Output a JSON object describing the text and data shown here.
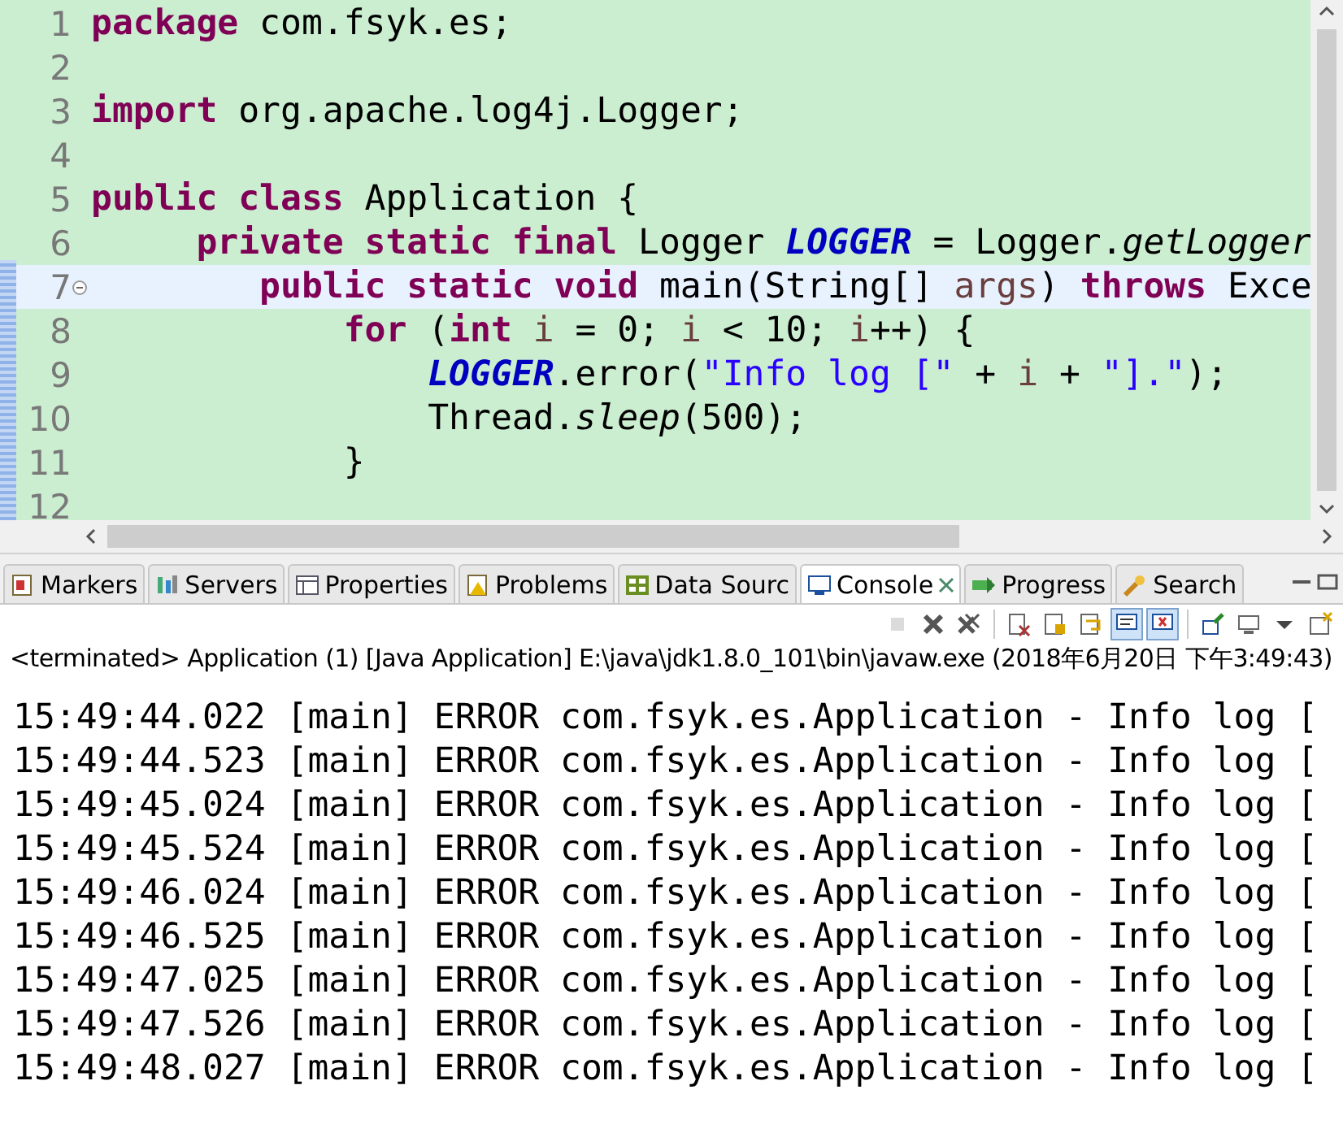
{
  "editor": {
    "lines": [
      {
        "number": "1",
        "current": false,
        "tokens": [
          {
            "kind": "keyword",
            "text": "package"
          },
          {
            "kind": "plain",
            "text": " com.fsyk.es;"
          }
        ]
      },
      {
        "number": "2",
        "current": false
      },
      {
        "number": "3",
        "current": false,
        "tokens": [
          {
            "kind": "keyword",
            "text": "import"
          },
          {
            "kind": "plain",
            "text": " org.apache.log4j.Logger;"
          }
        ]
      },
      {
        "number": "4",
        "current": false
      },
      {
        "number": "5",
        "current": false,
        "tokens": [
          {
            "kind": "keyword",
            "text": "public class"
          },
          {
            "kind": "plain",
            "text": " Application {"
          }
        ]
      },
      {
        "number": "6",
        "current": false,
        "tokens": [
          {
            "kind": "keyword",
            "text": "     private static final"
          },
          {
            "kind": "plain",
            "text": " Logger "
          },
          {
            "kind": "field",
            "text": "LOGGER"
          },
          {
            "kind": "plain",
            "text": " = Logger."
          },
          {
            "kind": "static_method",
            "text": "getLogger"
          }
        ]
      },
      {
        "number": "7",
        "current": true,
        "tokens": [
          {
            "kind": "keyword",
            "text": "        public static void"
          },
          {
            "kind": "plain",
            "text": " main(String[] "
          },
          {
            "kind": "local",
            "text": "args"
          },
          {
            "kind": "plain",
            "text": ") "
          },
          {
            "kind": "keyword",
            "text": "throws"
          },
          {
            "kind": "plain",
            "text": " Exce"
          }
        ]
      },
      {
        "number": "8",
        "current": false,
        "tokens": [
          {
            "kind": "keyword",
            "text": "            for"
          },
          {
            "kind": "plain",
            "text": " ("
          },
          {
            "kind": "keyword",
            "text": "int "
          },
          {
            "kind": "local",
            "text": "i"
          },
          {
            "kind": "plain",
            "text": " = 0; "
          },
          {
            "kind": "local",
            "text": "i"
          },
          {
            "kind": "plain",
            "text": " < 10; "
          },
          {
            "kind": "local",
            "text": "i"
          },
          {
            "kind": "plain",
            "text": "++) {"
          }
        ]
      },
      {
        "number": "9",
        "current": false,
        "tokens": [
          {
            "kind": "field",
            "text": "                LOGGER"
          },
          {
            "kind": "plain",
            "text": ".error("
          },
          {
            "kind": "string",
            "text": "\"Info log [\""
          },
          {
            "kind": "plain",
            "text": " + "
          },
          {
            "kind": "local",
            "text": "i"
          },
          {
            "kind": "plain",
            "text": " + "
          },
          {
            "kind": "string",
            "text": "\"].\""
          },
          {
            "kind": "plain",
            "text": ");"
          }
        ]
      },
      {
        "number": "10",
        "current": false,
        "tokens": [
          {
            "kind": "plain",
            "text": "                Thread."
          },
          {
            "kind": "static_method",
            "text": "sleep"
          },
          {
            "kind": "plain",
            "text": "(500);"
          }
        ]
      },
      {
        "number": "11",
        "current": false,
        "tokens": [
          {
            "kind": "plain",
            "text": "            }"
          }
        ]
      },
      {
        "number": "12",
        "current": false
      }
    ]
  },
  "views": {
    "tabs": [
      {
        "label": "Markers",
        "kind": "markers",
        "selected": false
      },
      {
        "label": "Servers",
        "kind": "servers",
        "selected": false
      },
      {
        "label": "Properties",
        "kind": "properties",
        "selected": false
      },
      {
        "label": "Problems",
        "kind": "problems",
        "selected": false
      },
      {
        "label": "Data Sourc",
        "kind": "datasource",
        "selected": false
      },
      {
        "label": "Console",
        "kind": "console",
        "selected": true
      },
      {
        "label": "Progress",
        "kind": "progress",
        "selected": false
      },
      {
        "label": "Search",
        "kind": "search",
        "selected": false
      }
    ]
  },
  "console": {
    "toolbar": [
      {
        "kind": "terminate",
        "disabled": true,
        "selected": false
      },
      {
        "kind": "remove",
        "disabled": false,
        "selected": false
      },
      {
        "kind": "remove_all",
        "disabled": false,
        "selected": false
      },
      {
        "kind": "separator"
      },
      {
        "kind": "clear",
        "disabled": false,
        "selected": false
      },
      {
        "kind": "scroll_lock",
        "disabled": false,
        "selected": false
      },
      {
        "kind": "word_wrap",
        "disabled": false,
        "selected": false
      },
      {
        "kind": "show_stdout",
        "disabled": false,
        "selected": true
      },
      {
        "kind": "show_stderr",
        "disabled": false,
        "selected": true
      },
      {
        "kind": "separator"
      },
      {
        "kind": "pin",
        "disabled": false,
        "selected": false
      },
      {
        "kind": "display",
        "disabled": false,
        "selected": false
      },
      {
        "kind": "dropdown",
        "disabled": false,
        "selected": false
      },
      {
        "kind": "new_console",
        "disabled": false,
        "selected": false
      }
    ],
    "process_label": "<terminated> Application (1) [Java Application] E:\\java\\jdk1.8.0_101\\bin\\javaw.exe (2018年6月20日 下午3:49:43)",
    "output": [
      "15:49:44.022 [main] ERROR com.fsyk.es.Application - Info log [",
      "15:49:44.523 [main] ERROR com.fsyk.es.Application - Info log [",
      "15:49:45.024 [main] ERROR com.fsyk.es.Application - Info log [",
      "15:49:45.524 [main] ERROR com.fsyk.es.Application - Info log [",
      "15:49:46.024 [main] ERROR com.fsyk.es.Application - Info log [",
      "15:49:46.525 [main] ERROR com.fsyk.es.Application - Info log [",
      "15:49:47.025 [main] ERROR com.fsyk.es.Application - Info log [",
      "15:49:47.526 [main] ERROR com.fsyk.es.Application - Info log [",
      "15:49:48.027 [main] ERROR com.fsyk.es.Application - Info log ["
    ]
  }
}
